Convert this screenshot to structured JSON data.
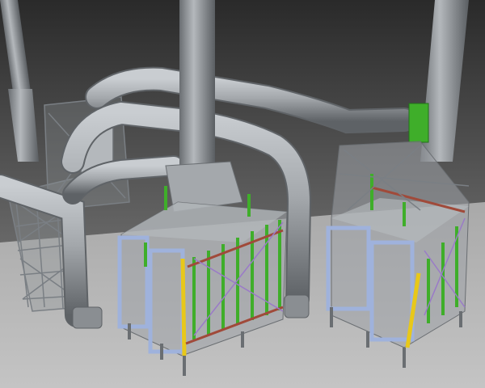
{
  "scene": {
    "subject": "3d-cad-industrial-plant",
    "colors": {
      "background_top": "#2c2c2c",
      "background_bottom": "#8a8a8a",
      "floor": "#b9b9b9",
      "steel": "#9ea3a8",
      "steel_dark": "#5f6469",
      "duct": "#a9adb1",
      "duct_shadow": "#6d7175",
      "frame_blue": "#9fb2dc",
      "frame_yellow": "#e8c81a",
      "brace_green": "#3fae2a",
      "brace_red": "#a04a3a",
      "brace_purple": "#9a7ac8"
    }
  }
}
